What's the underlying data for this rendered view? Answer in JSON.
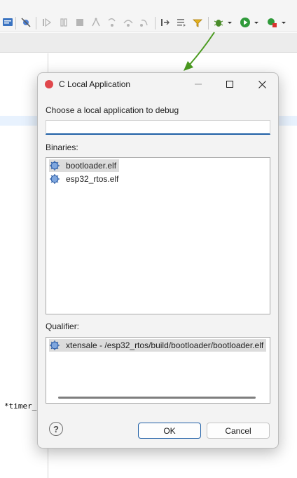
{
  "background": {
    "code_fragment": "*timer_"
  },
  "dialog": {
    "title": "C Local Application",
    "prompt": "Choose a local application to debug",
    "search": {
      "value": "",
      "placeholder": ""
    },
    "binaries_label": "Binaries:",
    "binaries": [
      {
        "name": "bootloader.elf",
        "selected": true
      },
      {
        "name": "esp32_rtos.elf",
        "selected": false
      }
    ],
    "qualifier_label": "Qualifier:",
    "qualifiers": [
      {
        "name": "xtensale - /esp32_rtos/build/bootloader/bootloader.elf",
        "selected": true
      }
    ],
    "ok_label": "OK",
    "cancel_label": "Cancel",
    "help_glyph": "?"
  },
  "icons": [
    "debug-bug-icon",
    "minimize-icon",
    "maximize-icon",
    "close-icon",
    "help-icon",
    "run-icon",
    "arrow-annotation"
  ],
  "colors": {
    "accent": "#1f5fa6",
    "annotation_arrow": "#4a9a1f",
    "selection": "#dcdcdc"
  }
}
